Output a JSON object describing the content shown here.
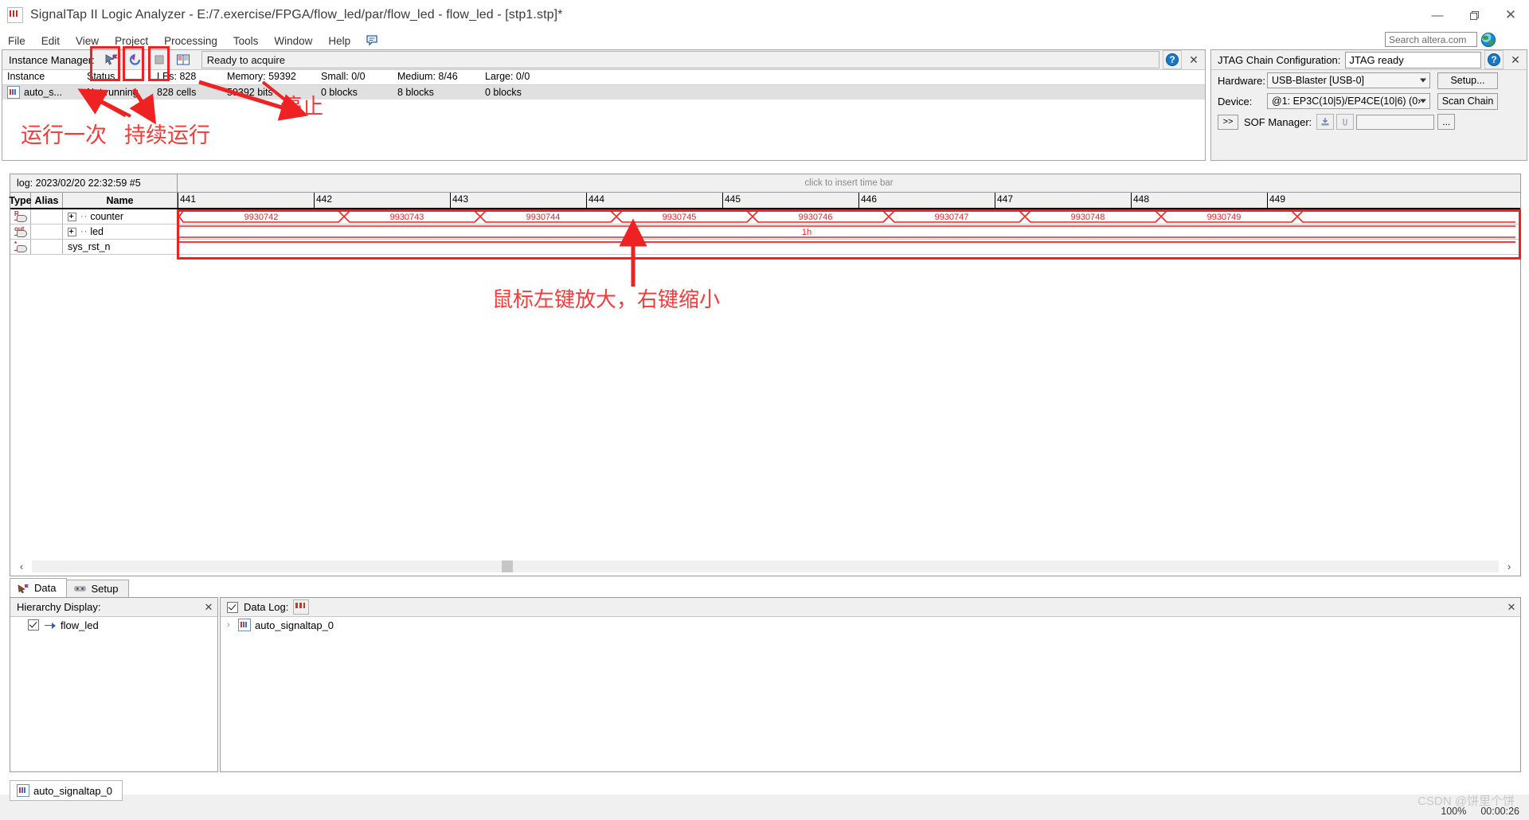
{
  "window": {
    "title": "SignalTap II Logic Analyzer - E:/7.exercise/FPGA/flow_led/par/flow_led - flow_led - [stp1.stp]*",
    "minimize": "—",
    "maximize": "❐",
    "close": "✕"
  },
  "menu": {
    "items": [
      "File",
      "Edit",
      "View",
      "Project",
      "Processing",
      "Tools",
      "Window",
      "Help"
    ]
  },
  "search": {
    "placeholder": "Search altera.com",
    "value": "Search altera.com",
    "icon": "globe-icon"
  },
  "instance_manager": {
    "title": "Instance Manager:",
    "status_text": "Ready to acquire",
    "toolbar": [
      {
        "name": "run-analysis-once-button",
        "tooltip": "Run Analysis"
      },
      {
        "name": "run-analysis-continuously-button",
        "tooltip": "Autorun Analysis"
      },
      {
        "name": "stop-analysis-button",
        "tooltip": "Stop Analysis"
      },
      {
        "name": "read-data-button",
        "tooltip": "Read Data"
      }
    ],
    "help_label": "?",
    "close_label": "✕",
    "columns": [
      "Instance",
      "Status",
      "LEs: 828",
      "Memory: 59392",
      "Small: 0/0",
      "Medium: 8/46",
      "Large: 0/0"
    ],
    "rows": [
      {
        "instance": "auto_s...",
        "status": "Not running",
        "les": "828 cells",
        "memory": "59392 bits",
        "small": "0 blocks",
        "medium": "8 blocks",
        "large": "0 blocks"
      }
    ]
  },
  "jtag": {
    "title": "JTAG Chain Configuration:",
    "status": "JTAG ready",
    "help_label": "?",
    "close_label": "✕",
    "hardware_label": "Hardware:",
    "hardware_value": "USB-Blaster [USB-0]",
    "setup_button": "Setup...",
    "device_label": "Device:",
    "device_value": "@1: EP3C(10|5)/EP4CE(10|6) (0›",
    "scan_button": "Scan Chain",
    "expand_button": ">>",
    "sof_label": "SOF Manager:",
    "sof_value": "",
    "dots_button": "..."
  },
  "waveform": {
    "log_label": "log: 2023/02/20 22:32:59  #5",
    "insert_hint": "click to insert time bar",
    "columns": [
      "Type",
      "Alias",
      "Name"
    ],
    "ticks": [
      "441",
      "442",
      "443",
      "444",
      "445",
      "446",
      "447",
      "448",
      "449"
    ],
    "signals": [
      {
        "type_icon": "register-signal-icon",
        "type_label": "R",
        "alias": "",
        "name": "counter",
        "expandable": true
      },
      {
        "type_icon": "output-signal-icon",
        "type_label": "out",
        "alias": "",
        "name": "led",
        "expandable": true
      },
      {
        "type_icon": "async-signal-icon",
        "type_label": "*",
        "alias": "",
        "name": "sys_rst_n",
        "expandable": false
      }
    ],
    "counter_values": [
      "9930742",
      "9930743",
      "9930744",
      "9930745",
      "9930746",
      "9930747",
      "9930748",
      "9930749"
    ],
    "led_value": "1h",
    "wave_color": "#ee2222",
    "scroll_left": "‹",
    "scroll_right": "›"
  },
  "tabs": [
    {
      "label": "Data",
      "icon": "data-tab-icon",
      "active": true
    },
    {
      "label": "Setup",
      "icon": "setup-tab-icon",
      "active": false
    }
  ],
  "hierarchy": {
    "title": "Hierarchy Display:",
    "close_label": "✕",
    "items": [
      {
        "label": "flow_led",
        "checked": true,
        "icon": "signal-icon"
      }
    ]
  },
  "data_log": {
    "title": "Data Log:",
    "checked": true,
    "close_label": "✕",
    "icon": "data-log-icon",
    "items": [
      {
        "label": "auto_signaltap_0",
        "caret": "›",
        "icon": "instance-icon"
      }
    ]
  },
  "statusbar": {
    "instance_tab": "auto_signaltap_0",
    "zoom": "100%",
    "elapsed": "00:00:26",
    "watermark": "CSDN @饼里个饼"
  },
  "annotations": {
    "run_once": "运行一次",
    "run_continuous": "持续运行",
    "stop": "停止",
    "zoom_hint": "鼠标左键放大，右键缩小",
    "color": "#f53a3a"
  },
  "colors": {
    "accent": "#1878c8",
    "annotation_red": "#ee2222",
    "wave_red": "#ee2222",
    "panel_bg": "#f0f0f0"
  }
}
